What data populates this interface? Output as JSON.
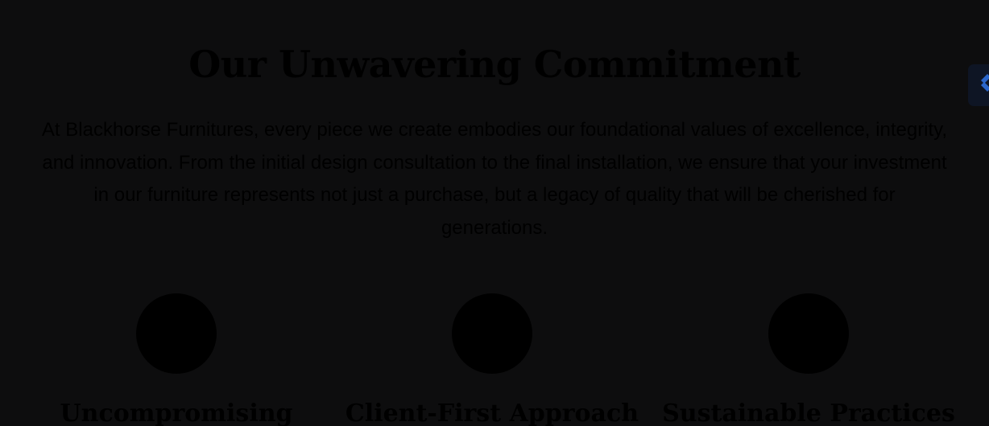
{
  "commitment": {
    "title": "Our Unwavering Commitment",
    "intro": "At Blackhorse Furnitures, every piece we create embodies our foundational values of excellence, integrity, and innovation. From the initial design consultation to the final installation, we ensure that your investment in our furniture represents not just a purchase, but a legacy of quality that will be cherished for generations."
  },
  "features": [
    {
      "icon": "circle-icon",
      "title": "Uncompromising"
    },
    {
      "icon": "circle-icon",
      "title": "Client-First Approach"
    },
    {
      "icon": "circle-icon",
      "title": "Sustainable Practices"
    }
  ],
  "edge_widget": {
    "icon": "chevron-icon",
    "accent": "#2b66c9"
  },
  "colors": {
    "background": "#0d0d0e",
    "text": "#000000",
    "icon_fill": "#000000"
  }
}
